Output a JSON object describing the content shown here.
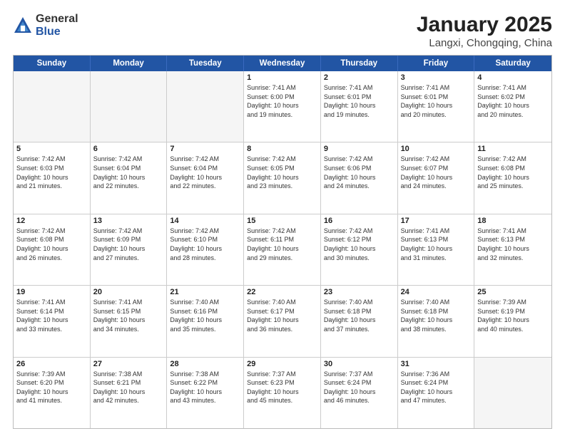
{
  "logo": {
    "general": "General",
    "blue": "Blue"
  },
  "title": "January 2025",
  "subtitle": "Langxi, Chongqing, China",
  "weekdays": [
    "Sunday",
    "Monday",
    "Tuesday",
    "Wednesday",
    "Thursday",
    "Friday",
    "Saturday"
  ],
  "rows": [
    [
      {
        "day": "",
        "info": ""
      },
      {
        "day": "",
        "info": ""
      },
      {
        "day": "",
        "info": ""
      },
      {
        "day": "1",
        "info": "Sunrise: 7:41 AM\nSunset: 6:00 PM\nDaylight: 10 hours\nand 19 minutes."
      },
      {
        "day": "2",
        "info": "Sunrise: 7:41 AM\nSunset: 6:01 PM\nDaylight: 10 hours\nand 19 minutes."
      },
      {
        "day": "3",
        "info": "Sunrise: 7:41 AM\nSunset: 6:01 PM\nDaylight: 10 hours\nand 20 minutes."
      },
      {
        "day": "4",
        "info": "Sunrise: 7:41 AM\nSunset: 6:02 PM\nDaylight: 10 hours\nand 20 minutes."
      }
    ],
    [
      {
        "day": "5",
        "info": "Sunrise: 7:42 AM\nSunset: 6:03 PM\nDaylight: 10 hours\nand 21 minutes."
      },
      {
        "day": "6",
        "info": "Sunrise: 7:42 AM\nSunset: 6:04 PM\nDaylight: 10 hours\nand 22 minutes."
      },
      {
        "day": "7",
        "info": "Sunrise: 7:42 AM\nSunset: 6:04 PM\nDaylight: 10 hours\nand 22 minutes."
      },
      {
        "day": "8",
        "info": "Sunrise: 7:42 AM\nSunset: 6:05 PM\nDaylight: 10 hours\nand 23 minutes."
      },
      {
        "day": "9",
        "info": "Sunrise: 7:42 AM\nSunset: 6:06 PM\nDaylight: 10 hours\nand 24 minutes."
      },
      {
        "day": "10",
        "info": "Sunrise: 7:42 AM\nSunset: 6:07 PM\nDaylight: 10 hours\nand 24 minutes."
      },
      {
        "day": "11",
        "info": "Sunrise: 7:42 AM\nSunset: 6:08 PM\nDaylight: 10 hours\nand 25 minutes."
      }
    ],
    [
      {
        "day": "12",
        "info": "Sunrise: 7:42 AM\nSunset: 6:08 PM\nDaylight: 10 hours\nand 26 minutes."
      },
      {
        "day": "13",
        "info": "Sunrise: 7:42 AM\nSunset: 6:09 PM\nDaylight: 10 hours\nand 27 minutes."
      },
      {
        "day": "14",
        "info": "Sunrise: 7:42 AM\nSunset: 6:10 PM\nDaylight: 10 hours\nand 28 minutes."
      },
      {
        "day": "15",
        "info": "Sunrise: 7:42 AM\nSunset: 6:11 PM\nDaylight: 10 hours\nand 29 minutes."
      },
      {
        "day": "16",
        "info": "Sunrise: 7:42 AM\nSunset: 6:12 PM\nDaylight: 10 hours\nand 30 minutes."
      },
      {
        "day": "17",
        "info": "Sunrise: 7:41 AM\nSunset: 6:13 PM\nDaylight: 10 hours\nand 31 minutes."
      },
      {
        "day": "18",
        "info": "Sunrise: 7:41 AM\nSunset: 6:13 PM\nDaylight: 10 hours\nand 32 minutes."
      }
    ],
    [
      {
        "day": "19",
        "info": "Sunrise: 7:41 AM\nSunset: 6:14 PM\nDaylight: 10 hours\nand 33 minutes."
      },
      {
        "day": "20",
        "info": "Sunrise: 7:41 AM\nSunset: 6:15 PM\nDaylight: 10 hours\nand 34 minutes."
      },
      {
        "day": "21",
        "info": "Sunrise: 7:40 AM\nSunset: 6:16 PM\nDaylight: 10 hours\nand 35 minutes."
      },
      {
        "day": "22",
        "info": "Sunrise: 7:40 AM\nSunset: 6:17 PM\nDaylight: 10 hours\nand 36 minutes."
      },
      {
        "day": "23",
        "info": "Sunrise: 7:40 AM\nSunset: 6:18 PM\nDaylight: 10 hours\nand 37 minutes."
      },
      {
        "day": "24",
        "info": "Sunrise: 7:40 AM\nSunset: 6:18 PM\nDaylight: 10 hours\nand 38 minutes."
      },
      {
        "day": "25",
        "info": "Sunrise: 7:39 AM\nSunset: 6:19 PM\nDaylight: 10 hours\nand 40 minutes."
      }
    ],
    [
      {
        "day": "26",
        "info": "Sunrise: 7:39 AM\nSunset: 6:20 PM\nDaylight: 10 hours\nand 41 minutes."
      },
      {
        "day": "27",
        "info": "Sunrise: 7:38 AM\nSunset: 6:21 PM\nDaylight: 10 hours\nand 42 minutes."
      },
      {
        "day": "28",
        "info": "Sunrise: 7:38 AM\nSunset: 6:22 PM\nDaylight: 10 hours\nand 43 minutes."
      },
      {
        "day": "29",
        "info": "Sunrise: 7:37 AM\nSunset: 6:23 PM\nDaylight: 10 hours\nand 45 minutes."
      },
      {
        "day": "30",
        "info": "Sunrise: 7:37 AM\nSunset: 6:24 PM\nDaylight: 10 hours\nand 46 minutes."
      },
      {
        "day": "31",
        "info": "Sunrise: 7:36 AM\nSunset: 6:24 PM\nDaylight: 10 hours\nand 47 minutes."
      },
      {
        "day": "",
        "info": ""
      }
    ]
  ]
}
